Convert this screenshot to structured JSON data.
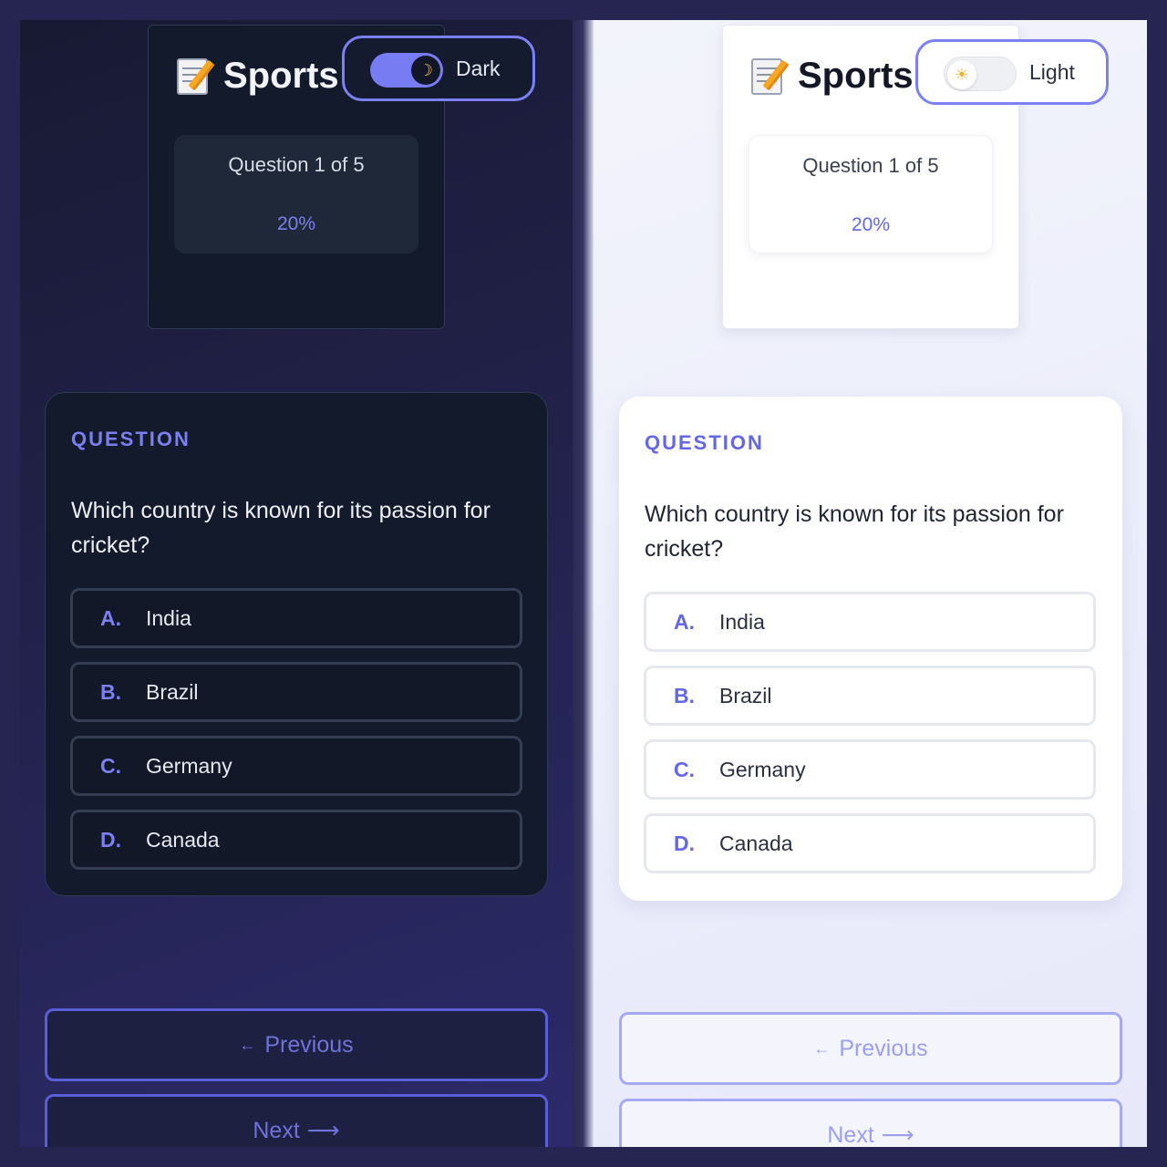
{
  "dark": {
    "brand": {
      "title": "Sports",
      "icon": "memo-icon"
    },
    "theme_toggle": {
      "label": "Dark",
      "icon": "moon-icon",
      "knob_glyph": "☽"
    },
    "progress": {
      "question_label": "Question 1 of 5",
      "percent": "20%"
    },
    "question": {
      "eyebrow": "QUESTION",
      "text": "Which country is known for its passion for cricket?",
      "options": [
        {
          "letter": "A.",
          "text": "India"
        },
        {
          "letter": "B.",
          "text": "Brazil"
        },
        {
          "letter": "C.",
          "text": "Germany"
        },
        {
          "letter": "D.",
          "text": "Canada"
        }
      ]
    },
    "nav": {
      "previous": "Previous",
      "next": "Next"
    }
  },
  "light": {
    "brand": {
      "title": "Sports",
      "icon": "memo-icon"
    },
    "theme_toggle": {
      "label": "Light",
      "icon": "sun-icon",
      "knob_glyph": "☀"
    },
    "progress": {
      "question_label": "Question 1 of 5",
      "percent": "20%"
    },
    "question": {
      "eyebrow": "QUESTION",
      "text": "Which country is known for its passion for cricket?",
      "options": [
        {
          "letter": "A.",
          "text": "India"
        },
        {
          "letter": "B.",
          "text": "Brazil"
        },
        {
          "letter": "C.",
          "text": "Germany"
        },
        {
          "letter": "D.",
          "text": "Canada"
        }
      ]
    },
    "nav": {
      "previous": "Previous",
      "next": "Next"
    }
  },
  "colors": {
    "accent": "#7b7ff0",
    "dark_card": "#131a2b",
    "light_card": "#ffffff"
  }
}
